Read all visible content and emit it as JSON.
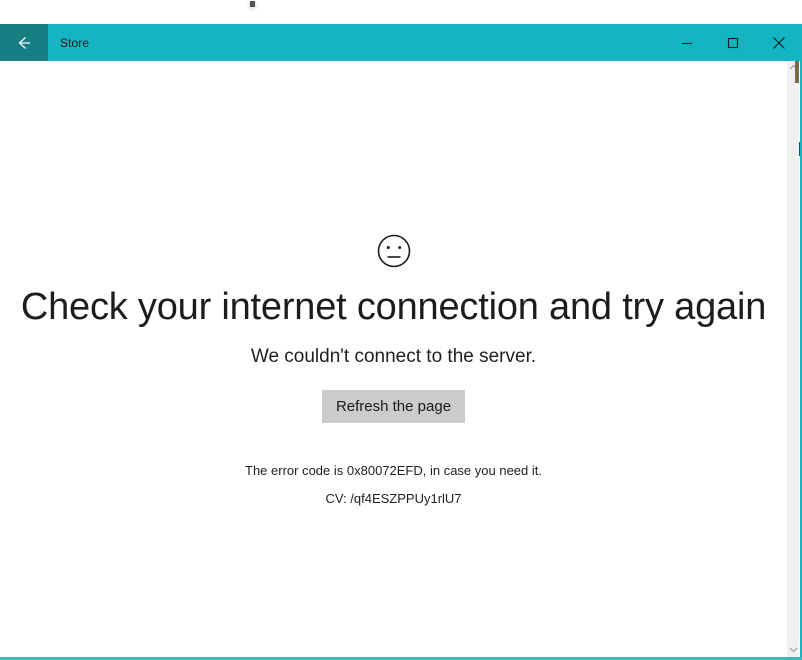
{
  "window": {
    "title": "Store",
    "back_icon": "back-arrow-icon",
    "minimize_icon": "minimize-icon",
    "maximize_icon": "maximize-icon",
    "close_icon": "close-icon",
    "titlebar_color": "#14b4c2",
    "back_button_color": "#177f83",
    "accent_border_color": "#3fb6bd"
  },
  "error_page": {
    "face_icon": "neutral-face-icon",
    "headline": "Check your internet connection and try again",
    "subtext": "We couldn't connect to the server.",
    "refresh_button_label": "Refresh the page",
    "error_code_text": "The error code is 0x80072EFD, in case you need it.",
    "correlation_vector_text": "CV: /qf4ESZPPUy1rlU7",
    "error_code": "0x80072EFD",
    "correlation_vector": "/qf4ESZPPUy1rlU7",
    "button_color": "#cccccc",
    "text_color": "#1f1f1f"
  },
  "scrollbar": {
    "up_arrow_icon": "chevron-up-icon",
    "down_arrow_icon": "chevron-down-icon",
    "track_color": "#f0f0f0",
    "thumb_color": "#cdcdcd"
  }
}
